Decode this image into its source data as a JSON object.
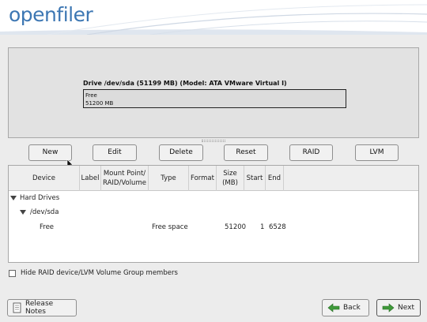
{
  "app": {
    "brand": "openfiler"
  },
  "drive": {
    "title": "Drive /dev/sda (51199 MB) (Model: ATA VMware Virtual I)",
    "segment_label": "Free",
    "segment_size": "51200 MB"
  },
  "toolbar": {
    "new_label": "New",
    "edit_label": "Edit",
    "delete_label": "Delete",
    "reset_label": "Reset",
    "raid_label": "RAID",
    "lvm_label": "LVM"
  },
  "table": {
    "headers": {
      "device": "Device",
      "label": "Label",
      "mount_line1": "Mount Point/",
      "mount_line2": "RAID/Volume",
      "type": "Type",
      "format": "Format",
      "size_line1": "Size",
      "size_line2": "(MB)",
      "start": "Start",
      "end": "End"
    },
    "tree": {
      "root": "Hard Drives",
      "disk": "/dev/sda"
    },
    "rows": [
      {
        "device": "Free",
        "type": "Free space",
        "size": "51200",
        "start": "1",
        "end": "6528"
      }
    ]
  },
  "options": {
    "hide_members_label": "Hide RAID device/LVM Volume Group members",
    "hide_members_checked": false
  },
  "footer": {
    "release_notes_label": "Release Notes",
    "back_label": "Back",
    "next_label": "Next"
  },
  "colors": {
    "brand": "#3d77b3",
    "arrow": "#3f9a3a"
  }
}
